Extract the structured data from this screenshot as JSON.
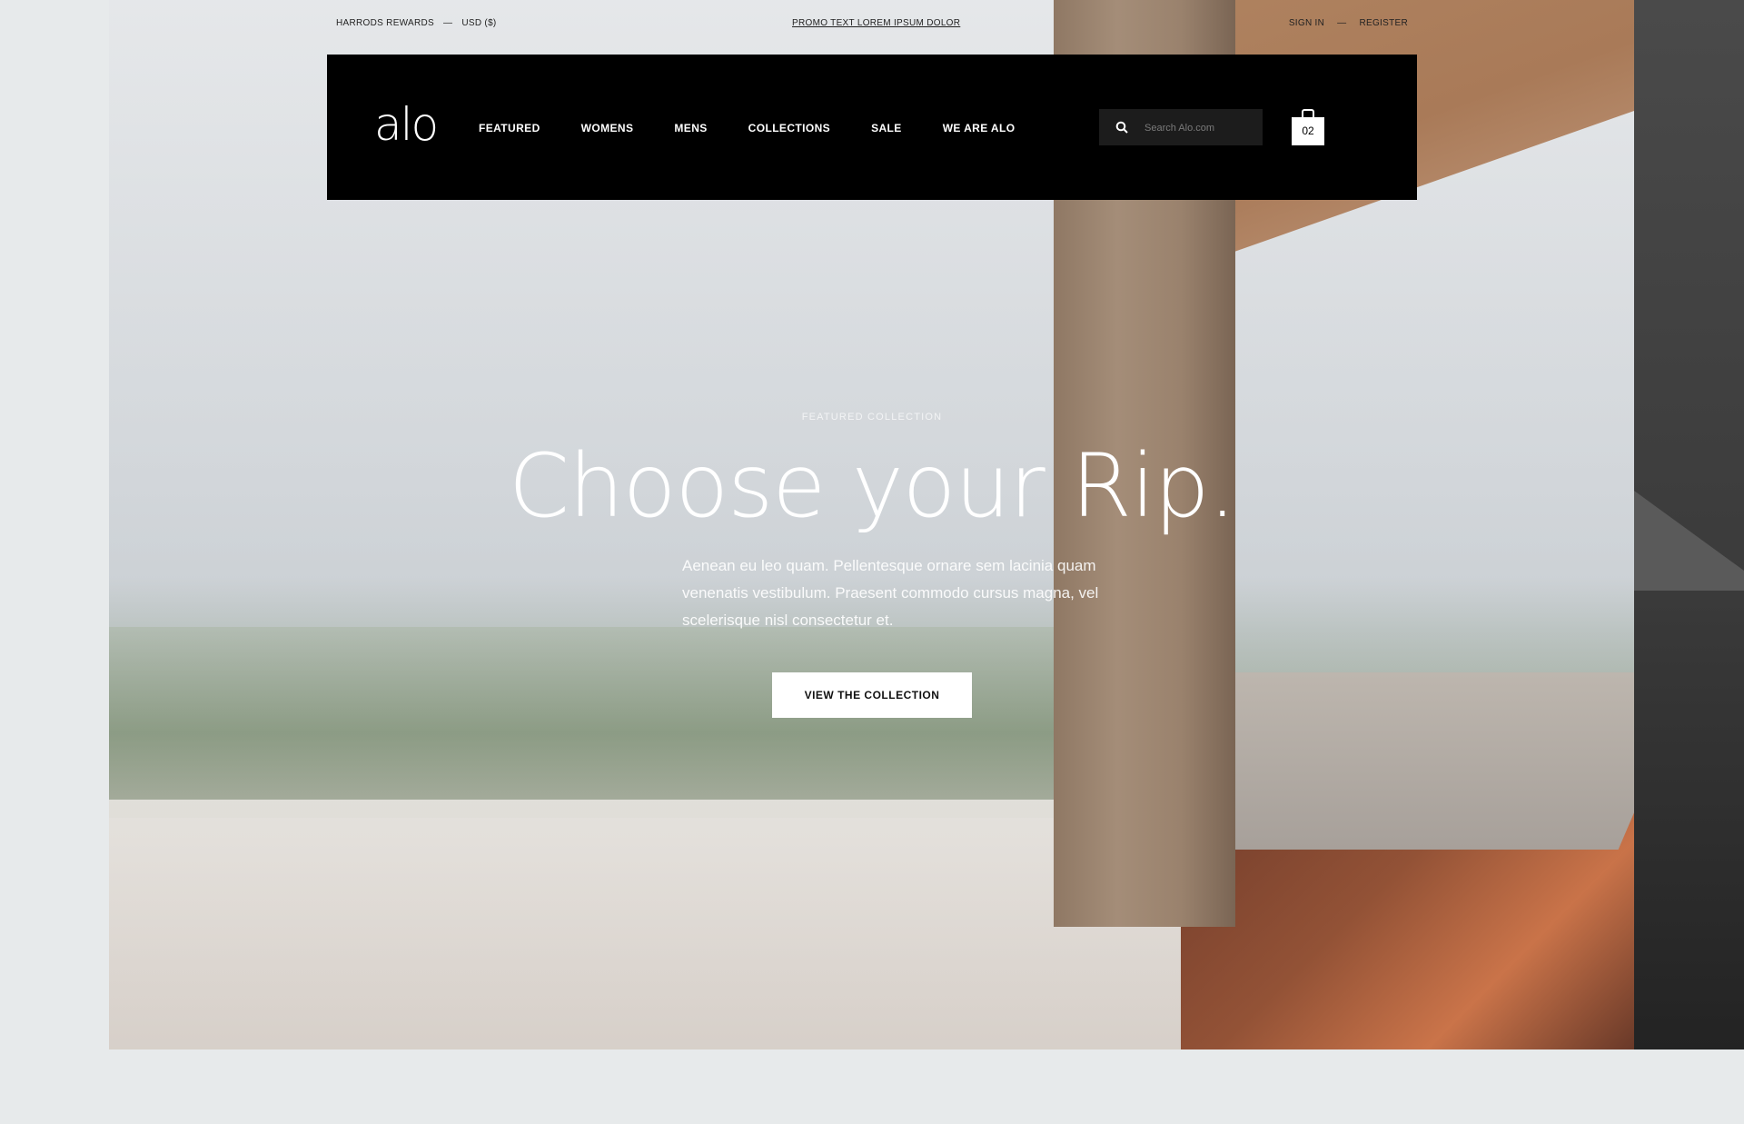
{
  "utility_bar": {
    "rewards": "HARRODS REWARDS",
    "separator": "—",
    "currency": "USD ($)",
    "promo": "PROMO TEXT LOREM IPSUM DOLOR",
    "sign_in": "SIGN IN",
    "register": "REGISTER"
  },
  "header": {
    "logo": "alo",
    "nav": [
      "FEATURED",
      "WOMENS",
      "MENS",
      "COLLECTIONS",
      "SALE",
      "WE ARE ALO"
    ],
    "search_placeholder": "Search Alo.com",
    "cart_count": "02"
  },
  "hero": {
    "eyebrow": "FEATURED COLLECTION",
    "headline": "Choose your Rip.",
    "body": "Aenean eu leo quam. Pellentesque ornare sem lacinia quam venenatis vestibulum. Praesent commodo cursus magna, vel scelerisque nisl consectetur et.",
    "cta": "VIEW THE COLLECTION"
  },
  "colors": {
    "nav_background": "#000000",
    "page_background": "#e7eaeb",
    "cta_background": "#ffffff"
  },
  "icons": [
    "search-icon",
    "shopping-bag-icon"
  ]
}
